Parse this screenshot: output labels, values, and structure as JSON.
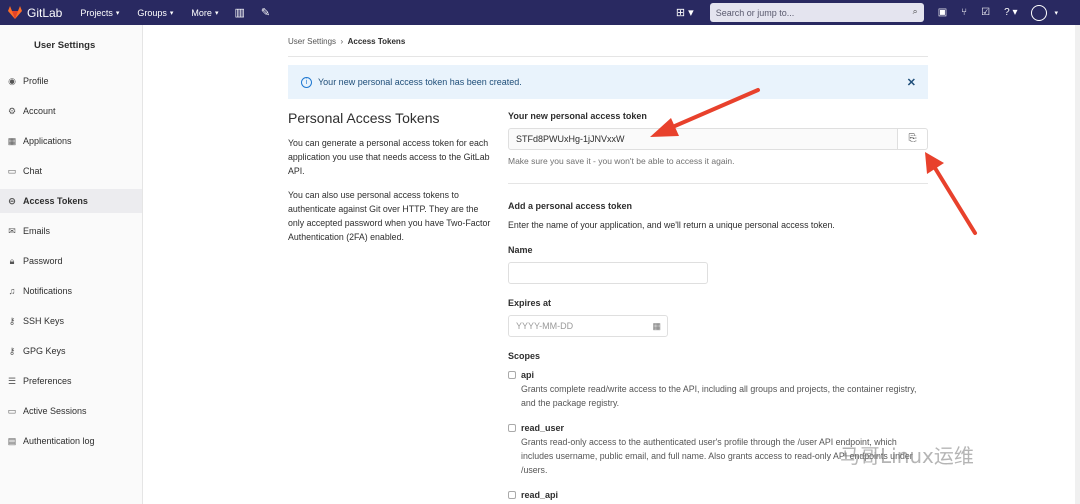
{
  "topbar": {
    "brand": "GitLab",
    "nav": [
      "Projects",
      "Groups",
      "More"
    ],
    "search_placeholder": "Search or jump to..."
  },
  "sidebar": {
    "title": "User Settings",
    "items": [
      {
        "label": "Profile",
        "icon": "profile-icon"
      },
      {
        "label": "Account",
        "icon": "account-icon"
      },
      {
        "label": "Applications",
        "icon": "applications-icon"
      },
      {
        "label": "Chat",
        "icon": "chat-icon"
      },
      {
        "label": "Access Tokens",
        "icon": "key-icon",
        "active": true
      },
      {
        "label": "Emails",
        "icon": "mail-icon"
      },
      {
        "label": "Password",
        "icon": "lock-icon"
      },
      {
        "label": "Notifications",
        "icon": "bell-icon"
      },
      {
        "label": "SSH Keys",
        "icon": "key-icon"
      },
      {
        "label": "GPG Keys",
        "icon": "key-icon"
      },
      {
        "label": "Preferences",
        "icon": "preferences-icon"
      },
      {
        "label": "Active Sessions",
        "icon": "monitor-icon"
      },
      {
        "label": "Authentication log",
        "icon": "log-icon"
      }
    ]
  },
  "breadcrumb": {
    "parent": "User Settings",
    "current": "Access Tokens"
  },
  "alert": {
    "message": "Your new personal access token has been created."
  },
  "intro": {
    "title": "Personal Access Tokens",
    "p1": "You can generate a personal access token for each application you use that needs access to the GitLab API.",
    "p2": "You can also use personal access tokens to authenticate against Git over HTTP. They are the only accepted password when you have Two-Factor Authentication (2FA) enabled."
  },
  "new_token": {
    "label": "Your new personal access token",
    "value": "STFd8PWUxHg-1jJNVxxW",
    "help": "Make sure you save it - you won't be able to access it again."
  },
  "add_token": {
    "title": "Add a personal access token",
    "desc": "Enter the name of your application, and we'll return a unique personal access token.",
    "name_label": "Name",
    "expires_label": "Expires at",
    "expires_placeholder": "YYYY-MM-DD",
    "scopes_label": "Scopes",
    "scopes": [
      {
        "name": "api",
        "desc": "Grants complete read/write access to the API, including all groups and projects, the container registry, and the package registry."
      },
      {
        "name": "read_user",
        "desc": "Grants read-only access to the authenticated user's profile through the /user API endpoint, which includes username, public email, and full name. Also grants access to read-only API endpoints under /users."
      },
      {
        "name": "read_api",
        "desc": ""
      }
    ]
  },
  "watermark": "马哥Linux运维",
  "colors": {
    "topbar": "#292961",
    "alert_bg": "#e9f3fc",
    "arrow": "#e8412c"
  }
}
